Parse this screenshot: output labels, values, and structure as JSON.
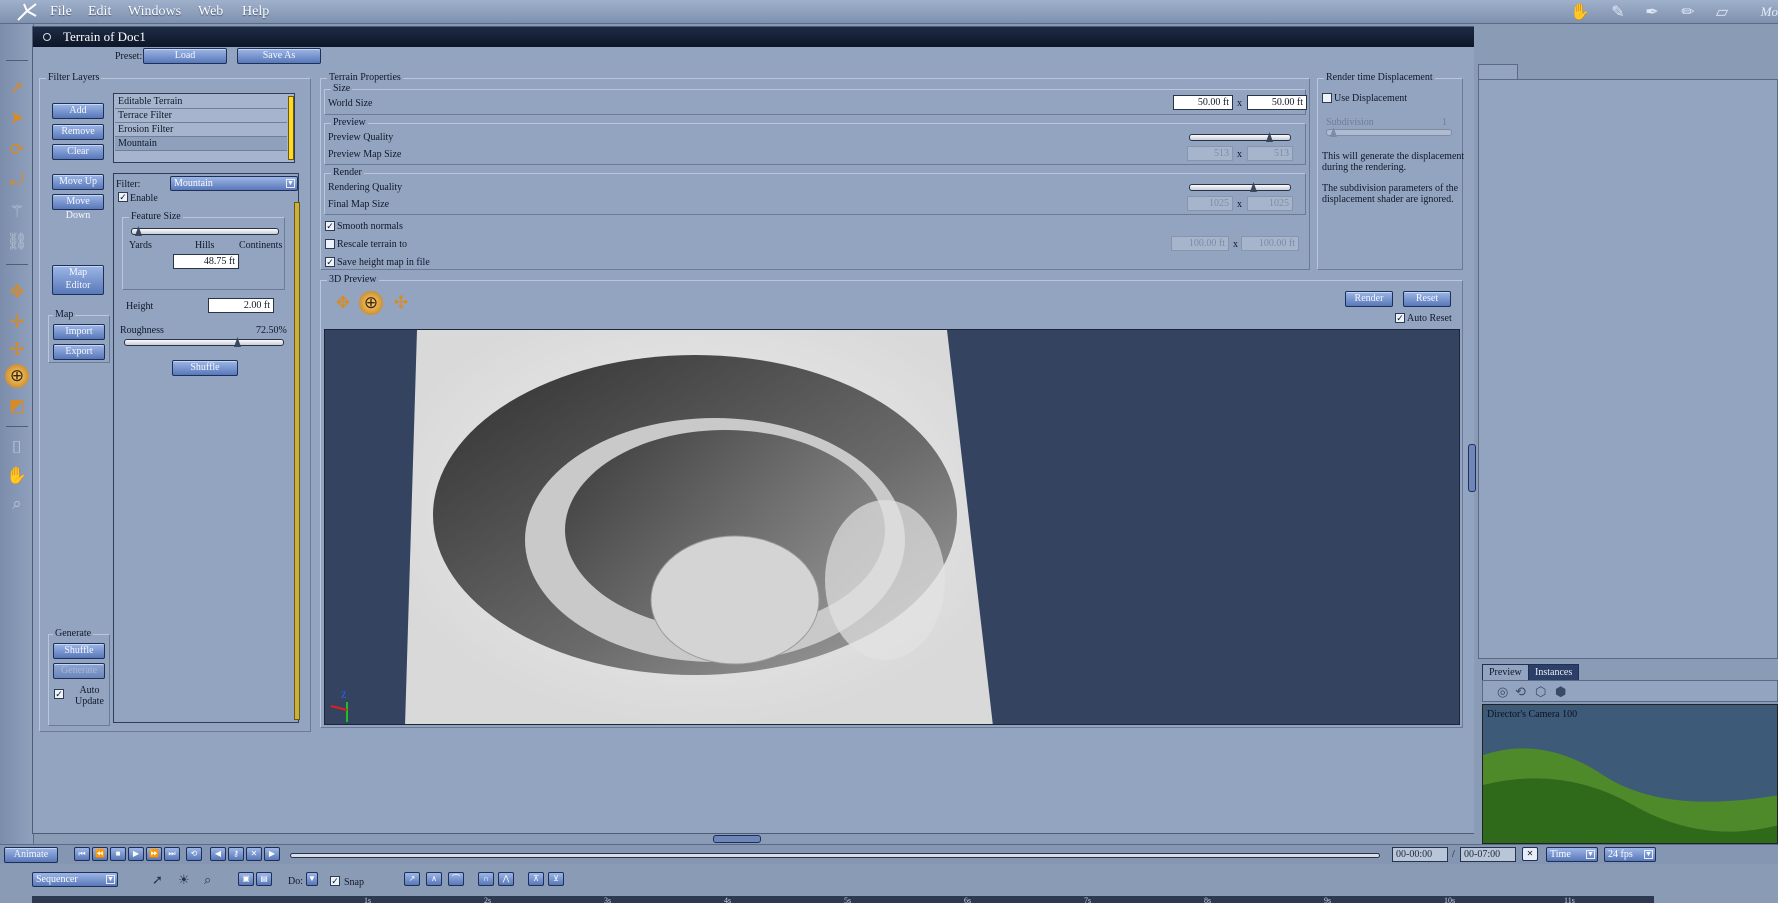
{
  "menubar": {
    "items": [
      "File",
      "Edit",
      "Windows",
      "Web",
      "Help"
    ],
    "right_label": "Mo"
  },
  "window": {
    "title": "Terrain of Doc1",
    "preset_label": "Preset:",
    "preset_load": "Load",
    "preset_save_as": "Save As"
  },
  "filter_layers": {
    "title": "Filter Layers",
    "add": "Add",
    "remove": "Remove",
    "clear": "Clear",
    "move_up": "Move Up",
    "move_down": "Move Down",
    "map_editor_1": "Map",
    "map_editor_2": "Editor",
    "layers": [
      "Editable Terrain",
      "Terrace Filter",
      "Erosion Filter",
      "Mountain"
    ],
    "selected_layer": "Mountain",
    "map_group": "Map",
    "import": "Import",
    "export": "Export",
    "generate_group": "Generate",
    "shuffle": "Shuffle",
    "generate": "Generate",
    "auto_update_1": "Auto",
    "auto_update_2": "Update"
  },
  "filter": {
    "label": "Filter:",
    "value": "Mountain",
    "enable": "Enable",
    "feature_size": "Feature Size",
    "yards": "Yards",
    "hills": "Hills",
    "continents": "Continents",
    "feature_value": "48.75 ft",
    "height_label": "Height",
    "height_value": "2.00 ft",
    "roughness_label": "Roughness",
    "roughness_value": "72.50%",
    "roughness_level": 0.725,
    "shuffle": "Shuffle"
  },
  "terrain_properties": {
    "title": "Terrain Properties",
    "size_group": "Size",
    "world_size_label": "World Size",
    "world_size_x": "50.00 ft",
    "world_size_y": "50.00 ft",
    "x_sep": "x",
    "preview_group": "Preview",
    "preview_quality_label": "Preview Quality",
    "preview_map_size_label": "Preview Map Size",
    "preview_map_x": "513",
    "preview_map_y": "513",
    "render_group": "Render",
    "rendering_quality_label": "Rendering Quality",
    "final_map_size_label": "Final Map Size",
    "final_map_x": "1025",
    "final_map_y": "1025",
    "smooth_normals": "Smooth normals",
    "rescale_terrain": "Rescale terrain to",
    "rescale_x": "100.00 ft",
    "rescale_y": "100.00 ft",
    "save_height_map": "Save height map in file"
  },
  "render_time": {
    "title": "Render time Displacement",
    "use_displacement": "Use Displacement",
    "subdivision_label": "Subdivision",
    "subdivision_value": "1",
    "note1_line1": "This will generate the displacement",
    "note1_line2": "during the rendering.",
    "note2_line1": "The subdivision parameters of the",
    "note2_line2": "displacement shader are ignored."
  },
  "preview3d": {
    "title": "3D Preview",
    "render": "Render",
    "reset": "Reset",
    "auto_reset": "Auto Reset",
    "axis_z": "Z",
    "axis_y": "Y",
    "axis_x": "X"
  },
  "right_panel": {
    "tabs": [
      "Preview",
      "Instances"
    ],
    "camera_label": "Director's Camera 100"
  },
  "timeline": {
    "animate": "Animate",
    "time_start": "00-00:00",
    "time_sep": "/",
    "time_end": "00-07:00",
    "time_mode": "Time",
    "fps": "24 fps",
    "sequencer": "Sequencer",
    "do_label": "Do:",
    "snap": "Snap",
    "ticks": [
      "1s",
      "2s",
      "3s",
      "4s",
      "5s",
      "6s",
      "7s",
      "8s",
      "9s",
      "10s",
      "11s"
    ]
  }
}
